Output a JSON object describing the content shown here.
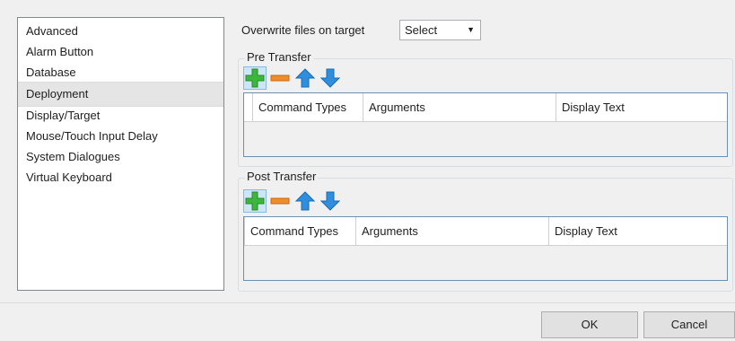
{
  "settings_nav": {
    "items": [
      {
        "label": "Advanced"
      },
      {
        "label": "Alarm Button"
      },
      {
        "label": "Database"
      },
      {
        "label": "Deployment",
        "selected": true
      },
      {
        "label": "Display/Target"
      },
      {
        "label": "Mouse/Touch Input Delay"
      },
      {
        "label": "System Dialogues"
      },
      {
        "label": "Virtual Keyboard"
      }
    ]
  },
  "deployment": {
    "overwrite_label": "Overwrite files on target",
    "overwrite_value": "Select",
    "pre_transfer": {
      "title": "Pre Transfer",
      "toolbar": [
        "add-icon",
        "remove-icon",
        "move-up-icon",
        "move-down-icon"
      ],
      "columns": [
        "Command Types",
        "Arguments",
        "Display Text"
      ]
    },
    "post_transfer": {
      "title": "Post Transfer",
      "toolbar": [
        "add-icon",
        "remove-icon",
        "move-up-icon",
        "move-down-icon"
      ],
      "columns": [
        "Command Types",
        "Arguments",
        "Display Text"
      ]
    }
  },
  "footer": {
    "ok_label": "OK",
    "cancel_label": "Cancel"
  },
  "colors": {
    "add": "#3cb73c",
    "remove": "#f08c2a",
    "arrow": "#2f8fde"
  }
}
